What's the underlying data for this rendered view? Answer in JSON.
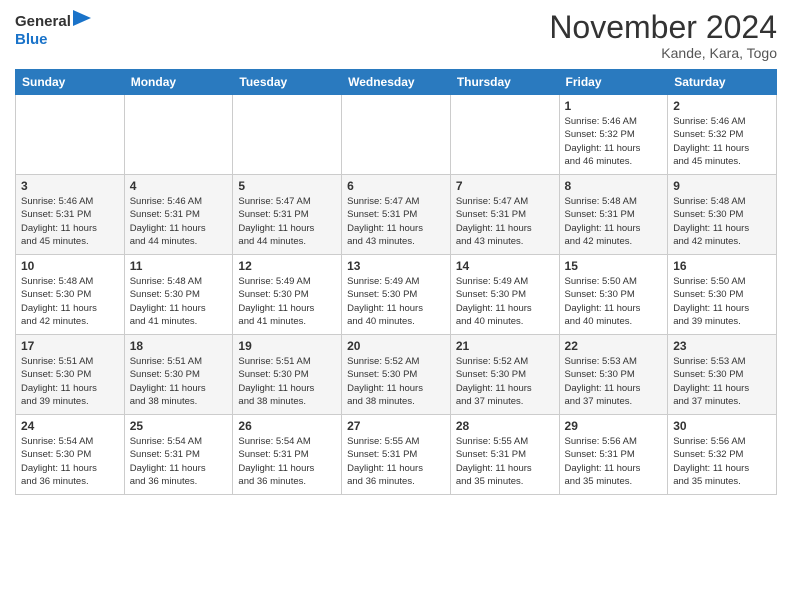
{
  "header": {
    "logo_line1": "General",
    "logo_line2": "Blue",
    "month": "November 2024",
    "location": "Kande, Kara, Togo"
  },
  "weekdays": [
    "Sunday",
    "Monday",
    "Tuesday",
    "Wednesday",
    "Thursday",
    "Friday",
    "Saturday"
  ],
  "weeks": [
    [
      {
        "day": "",
        "info": ""
      },
      {
        "day": "",
        "info": ""
      },
      {
        "day": "",
        "info": ""
      },
      {
        "day": "",
        "info": ""
      },
      {
        "day": "",
        "info": ""
      },
      {
        "day": "1",
        "info": "Sunrise: 5:46 AM\nSunset: 5:32 PM\nDaylight: 11 hours\nand 46 minutes."
      },
      {
        "day": "2",
        "info": "Sunrise: 5:46 AM\nSunset: 5:32 PM\nDaylight: 11 hours\nand 45 minutes."
      }
    ],
    [
      {
        "day": "3",
        "info": "Sunrise: 5:46 AM\nSunset: 5:31 PM\nDaylight: 11 hours\nand 45 minutes."
      },
      {
        "day": "4",
        "info": "Sunrise: 5:46 AM\nSunset: 5:31 PM\nDaylight: 11 hours\nand 44 minutes."
      },
      {
        "day": "5",
        "info": "Sunrise: 5:47 AM\nSunset: 5:31 PM\nDaylight: 11 hours\nand 44 minutes."
      },
      {
        "day": "6",
        "info": "Sunrise: 5:47 AM\nSunset: 5:31 PM\nDaylight: 11 hours\nand 43 minutes."
      },
      {
        "day": "7",
        "info": "Sunrise: 5:47 AM\nSunset: 5:31 PM\nDaylight: 11 hours\nand 43 minutes."
      },
      {
        "day": "8",
        "info": "Sunrise: 5:48 AM\nSunset: 5:31 PM\nDaylight: 11 hours\nand 42 minutes."
      },
      {
        "day": "9",
        "info": "Sunrise: 5:48 AM\nSunset: 5:30 PM\nDaylight: 11 hours\nand 42 minutes."
      }
    ],
    [
      {
        "day": "10",
        "info": "Sunrise: 5:48 AM\nSunset: 5:30 PM\nDaylight: 11 hours\nand 42 minutes."
      },
      {
        "day": "11",
        "info": "Sunrise: 5:48 AM\nSunset: 5:30 PM\nDaylight: 11 hours\nand 41 minutes."
      },
      {
        "day": "12",
        "info": "Sunrise: 5:49 AM\nSunset: 5:30 PM\nDaylight: 11 hours\nand 41 minutes."
      },
      {
        "day": "13",
        "info": "Sunrise: 5:49 AM\nSunset: 5:30 PM\nDaylight: 11 hours\nand 40 minutes."
      },
      {
        "day": "14",
        "info": "Sunrise: 5:49 AM\nSunset: 5:30 PM\nDaylight: 11 hours\nand 40 minutes."
      },
      {
        "day": "15",
        "info": "Sunrise: 5:50 AM\nSunset: 5:30 PM\nDaylight: 11 hours\nand 40 minutes."
      },
      {
        "day": "16",
        "info": "Sunrise: 5:50 AM\nSunset: 5:30 PM\nDaylight: 11 hours\nand 39 minutes."
      }
    ],
    [
      {
        "day": "17",
        "info": "Sunrise: 5:51 AM\nSunset: 5:30 PM\nDaylight: 11 hours\nand 39 minutes."
      },
      {
        "day": "18",
        "info": "Sunrise: 5:51 AM\nSunset: 5:30 PM\nDaylight: 11 hours\nand 38 minutes."
      },
      {
        "day": "19",
        "info": "Sunrise: 5:51 AM\nSunset: 5:30 PM\nDaylight: 11 hours\nand 38 minutes."
      },
      {
        "day": "20",
        "info": "Sunrise: 5:52 AM\nSunset: 5:30 PM\nDaylight: 11 hours\nand 38 minutes."
      },
      {
        "day": "21",
        "info": "Sunrise: 5:52 AM\nSunset: 5:30 PM\nDaylight: 11 hours\nand 37 minutes."
      },
      {
        "day": "22",
        "info": "Sunrise: 5:53 AM\nSunset: 5:30 PM\nDaylight: 11 hours\nand 37 minutes."
      },
      {
        "day": "23",
        "info": "Sunrise: 5:53 AM\nSunset: 5:30 PM\nDaylight: 11 hours\nand 37 minutes."
      }
    ],
    [
      {
        "day": "24",
        "info": "Sunrise: 5:54 AM\nSunset: 5:30 PM\nDaylight: 11 hours\nand 36 minutes."
      },
      {
        "day": "25",
        "info": "Sunrise: 5:54 AM\nSunset: 5:31 PM\nDaylight: 11 hours\nand 36 minutes."
      },
      {
        "day": "26",
        "info": "Sunrise: 5:54 AM\nSunset: 5:31 PM\nDaylight: 11 hours\nand 36 minutes."
      },
      {
        "day": "27",
        "info": "Sunrise: 5:55 AM\nSunset: 5:31 PM\nDaylight: 11 hours\nand 36 minutes."
      },
      {
        "day": "28",
        "info": "Sunrise: 5:55 AM\nSunset: 5:31 PM\nDaylight: 11 hours\nand 35 minutes."
      },
      {
        "day": "29",
        "info": "Sunrise: 5:56 AM\nSunset: 5:31 PM\nDaylight: 11 hours\nand 35 minutes."
      },
      {
        "day": "30",
        "info": "Sunrise: 5:56 AM\nSunset: 5:32 PM\nDaylight: 11 hours\nand 35 minutes."
      }
    ]
  ]
}
